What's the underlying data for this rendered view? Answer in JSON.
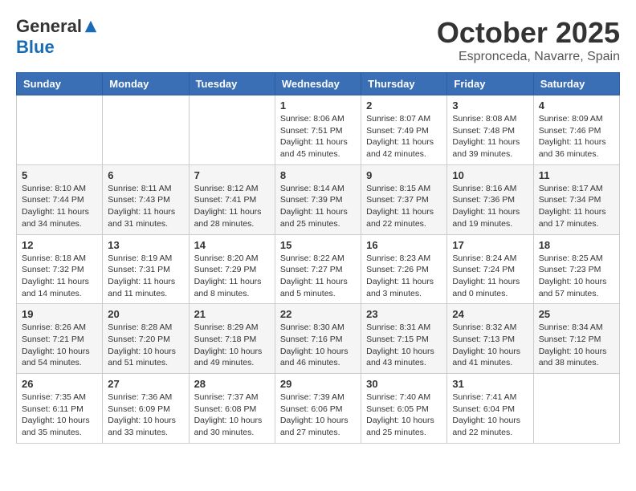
{
  "header": {
    "logo_general": "General",
    "logo_blue": "Blue",
    "month_title": "October 2025",
    "location": "Espronceda, Navarre, Spain"
  },
  "days_of_week": [
    "Sunday",
    "Monday",
    "Tuesday",
    "Wednesday",
    "Thursday",
    "Friday",
    "Saturday"
  ],
  "weeks": [
    [
      {
        "day": "",
        "info": ""
      },
      {
        "day": "",
        "info": ""
      },
      {
        "day": "",
        "info": ""
      },
      {
        "day": "1",
        "info": "Sunrise: 8:06 AM\nSunset: 7:51 PM\nDaylight: 11 hours\nand 45 minutes."
      },
      {
        "day": "2",
        "info": "Sunrise: 8:07 AM\nSunset: 7:49 PM\nDaylight: 11 hours\nand 42 minutes."
      },
      {
        "day": "3",
        "info": "Sunrise: 8:08 AM\nSunset: 7:48 PM\nDaylight: 11 hours\nand 39 minutes."
      },
      {
        "day": "4",
        "info": "Sunrise: 8:09 AM\nSunset: 7:46 PM\nDaylight: 11 hours\nand 36 minutes."
      }
    ],
    [
      {
        "day": "5",
        "info": "Sunrise: 8:10 AM\nSunset: 7:44 PM\nDaylight: 11 hours\nand 34 minutes."
      },
      {
        "day": "6",
        "info": "Sunrise: 8:11 AM\nSunset: 7:43 PM\nDaylight: 11 hours\nand 31 minutes."
      },
      {
        "day": "7",
        "info": "Sunrise: 8:12 AM\nSunset: 7:41 PM\nDaylight: 11 hours\nand 28 minutes."
      },
      {
        "day": "8",
        "info": "Sunrise: 8:14 AM\nSunset: 7:39 PM\nDaylight: 11 hours\nand 25 minutes."
      },
      {
        "day": "9",
        "info": "Sunrise: 8:15 AM\nSunset: 7:37 PM\nDaylight: 11 hours\nand 22 minutes."
      },
      {
        "day": "10",
        "info": "Sunrise: 8:16 AM\nSunset: 7:36 PM\nDaylight: 11 hours\nand 19 minutes."
      },
      {
        "day": "11",
        "info": "Sunrise: 8:17 AM\nSunset: 7:34 PM\nDaylight: 11 hours\nand 17 minutes."
      }
    ],
    [
      {
        "day": "12",
        "info": "Sunrise: 8:18 AM\nSunset: 7:32 PM\nDaylight: 11 hours\nand 14 minutes."
      },
      {
        "day": "13",
        "info": "Sunrise: 8:19 AM\nSunset: 7:31 PM\nDaylight: 11 hours\nand 11 minutes."
      },
      {
        "day": "14",
        "info": "Sunrise: 8:20 AM\nSunset: 7:29 PM\nDaylight: 11 hours\nand 8 minutes."
      },
      {
        "day": "15",
        "info": "Sunrise: 8:22 AM\nSunset: 7:27 PM\nDaylight: 11 hours\nand 5 minutes."
      },
      {
        "day": "16",
        "info": "Sunrise: 8:23 AM\nSunset: 7:26 PM\nDaylight: 11 hours\nand 3 minutes."
      },
      {
        "day": "17",
        "info": "Sunrise: 8:24 AM\nSunset: 7:24 PM\nDaylight: 11 hours\nand 0 minutes."
      },
      {
        "day": "18",
        "info": "Sunrise: 8:25 AM\nSunset: 7:23 PM\nDaylight: 10 hours\nand 57 minutes."
      }
    ],
    [
      {
        "day": "19",
        "info": "Sunrise: 8:26 AM\nSunset: 7:21 PM\nDaylight: 10 hours\nand 54 minutes."
      },
      {
        "day": "20",
        "info": "Sunrise: 8:28 AM\nSunset: 7:20 PM\nDaylight: 10 hours\nand 51 minutes."
      },
      {
        "day": "21",
        "info": "Sunrise: 8:29 AM\nSunset: 7:18 PM\nDaylight: 10 hours\nand 49 minutes."
      },
      {
        "day": "22",
        "info": "Sunrise: 8:30 AM\nSunset: 7:16 PM\nDaylight: 10 hours\nand 46 minutes."
      },
      {
        "day": "23",
        "info": "Sunrise: 8:31 AM\nSunset: 7:15 PM\nDaylight: 10 hours\nand 43 minutes."
      },
      {
        "day": "24",
        "info": "Sunrise: 8:32 AM\nSunset: 7:13 PM\nDaylight: 10 hours\nand 41 minutes."
      },
      {
        "day": "25",
        "info": "Sunrise: 8:34 AM\nSunset: 7:12 PM\nDaylight: 10 hours\nand 38 minutes."
      }
    ],
    [
      {
        "day": "26",
        "info": "Sunrise: 7:35 AM\nSunset: 6:11 PM\nDaylight: 10 hours\nand 35 minutes."
      },
      {
        "day": "27",
        "info": "Sunrise: 7:36 AM\nSunset: 6:09 PM\nDaylight: 10 hours\nand 33 minutes."
      },
      {
        "day": "28",
        "info": "Sunrise: 7:37 AM\nSunset: 6:08 PM\nDaylight: 10 hours\nand 30 minutes."
      },
      {
        "day": "29",
        "info": "Sunrise: 7:39 AM\nSunset: 6:06 PM\nDaylight: 10 hours\nand 27 minutes."
      },
      {
        "day": "30",
        "info": "Sunrise: 7:40 AM\nSunset: 6:05 PM\nDaylight: 10 hours\nand 25 minutes."
      },
      {
        "day": "31",
        "info": "Sunrise: 7:41 AM\nSunset: 6:04 PM\nDaylight: 10 hours\nand 22 minutes."
      },
      {
        "day": "",
        "info": ""
      }
    ]
  ]
}
